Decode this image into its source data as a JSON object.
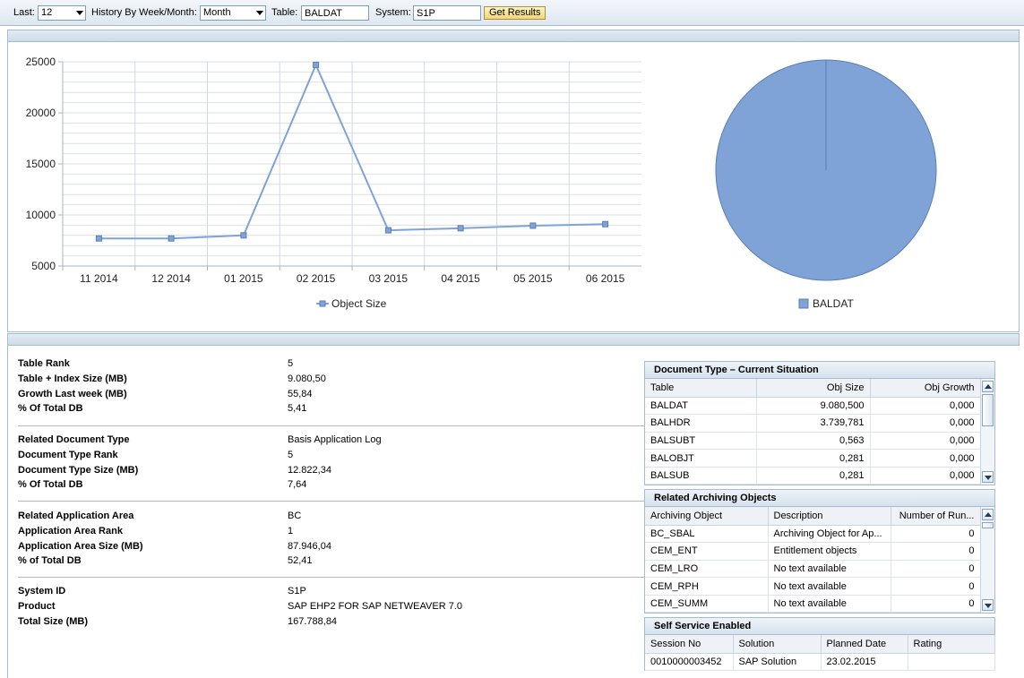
{
  "toolbar": {
    "last_label": "Last:",
    "last_value": "12",
    "history_label": "History By Week/Month:",
    "history_value": "Month",
    "table_label": "Table:",
    "table_value": "BALDAT",
    "system_label": "System:",
    "system_value": "S1P",
    "button_label": "Get Results"
  },
  "chart_data": [
    {
      "type": "line",
      "categories": [
        "11 2014",
        "12 2014",
        "01 2015",
        "02 2015",
        "03 2015",
        "04 2015",
        "05 2015",
        "06 2015"
      ],
      "series": [
        {
          "name": "Object Size",
          "values": [
            7700,
            7700,
            8000,
            24700,
            8500,
            8700,
            8950,
            9100
          ]
        }
      ],
      "ylim": [
        5000,
        25000
      ],
      "yticks": [
        5000,
        10000,
        15000,
        20000,
        25000
      ],
      "grid": true,
      "legend": "bottom",
      "color": "#7fa3d6"
    },
    {
      "type": "pie",
      "labels": [
        "BALDAT"
      ],
      "values": [
        100
      ],
      "legend": "bottom",
      "color": "#7fa3d6"
    }
  ],
  "details": {
    "group1": [
      {
        "label": "Table Rank",
        "value": "5"
      },
      {
        "label": "Table + Index Size (MB)",
        "value": "9.080,50"
      },
      {
        "label": "Growth Last week (MB)",
        "value": "55,84"
      },
      {
        "label": "% Of Total DB",
        "value": "5,41"
      }
    ],
    "group2": [
      {
        "label": "Related Document Type",
        "value": "Basis Application Log"
      },
      {
        "label": "Document Type Rank",
        "value": "5"
      },
      {
        "label": "Document Type Size (MB)",
        "value": "12.822,34"
      },
      {
        "label": "% Of Total DB",
        "value": "7,64"
      }
    ],
    "group3": [
      {
        "label": "Related Application Area",
        "value": "BC"
      },
      {
        "label": "Application Area Rank",
        "value": "1"
      },
      {
        "label": "Application Area Size (MB)",
        "value": "87.946,04"
      },
      {
        "label": "% of Total DB",
        "value": "52,41"
      }
    ],
    "group4": [
      {
        "label": "System ID",
        "value": "S1P"
      },
      {
        "label": "Product",
        "value": "SAP EHP2 FOR SAP NETWEAVER 7.0"
      },
      {
        "label": "Total Size (MB)",
        "value": "167.788,84"
      }
    ]
  },
  "doc_type": {
    "title": "Document Type – Current Situation",
    "columns": [
      "Table",
      "Obj Size",
      "Obj Growth"
    ],
    "rows": [
      [
        "BALDAT",
        "9.080,500",
        "0,000"
      ],
      [
        "BALHDR",
        "3.739,781",
        "0,000"
      ],
      [
        "BALSUBT",
        "0,563",
        "0,000"
      ],
      [
        "BALOBJT",
        "0,281",
        "0,000"
      ],
      [
        "BALSUB",
        "0,281",
        "0,000"
      ]
    ]
  },
  "archiving": {
    "title": "Related Archiving Objects",
    "columns": [
      "Archiving Object",
      "Description",
      "Number of Run..."
    ],
    "rows": [
      [
        "BC_SBAL",
        "Archiving Object for Ap...",
        "0"
      ],
      [
        "CEM_ENT",
        "Entitlement objects",
        "0"
      ],
      [
        "CEM_LRO",
        "No text available",
        "0"
      ],
      [
        "CEM_RPH",
        "No text available",
        "0"
      ],
      [
        "CEM_SUMM",
        "No text available",
        "0"
      ]
    ]
  },
  "self_service": {
    "title": "Self Service Enabled",
    "columns": [
      "Session No",
      "Solution",
      "Planned Date",
      "Rating"
    ],
    "rows": [
      [
        "0010000003452",
        "SAP Solution",
        "23.02.2015",
        ""
      ]
    ]
  }
}
